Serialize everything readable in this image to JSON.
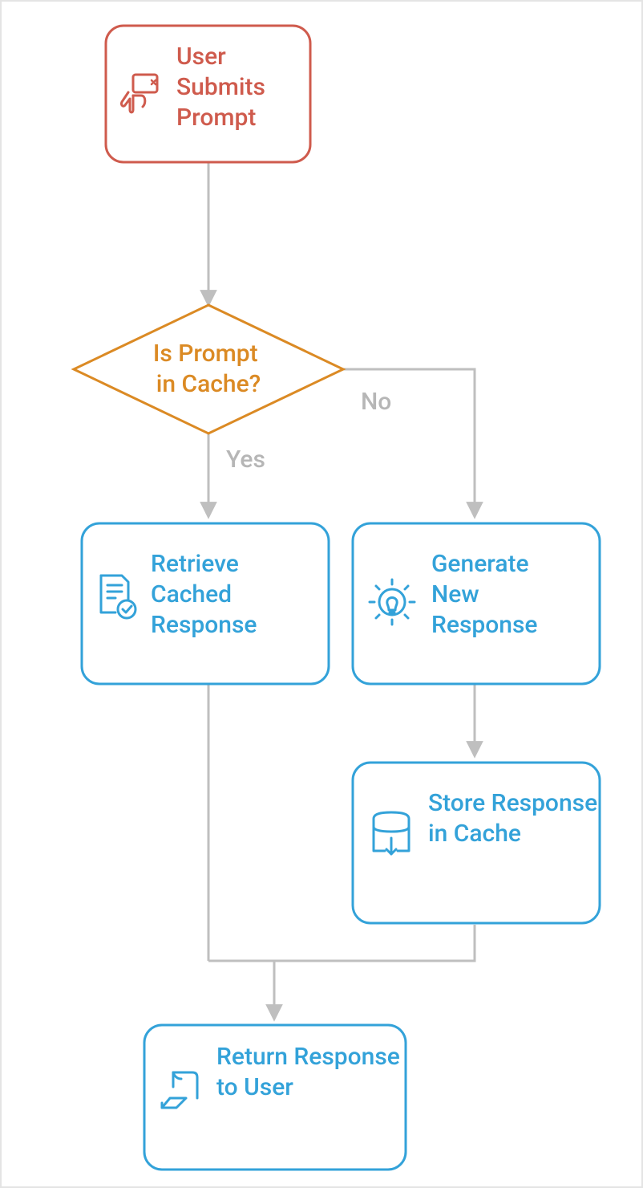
{
  "diagram": {
    "type": "flowchart",
    "direction": "top-to-bottom",
    "nodes": {
      "submit": {
        "label": "User Submits Prompt",
        "kind": "process",
        "color": "#cf5b4d",
        "icon": "touch-icon"
      },
      "decision": {
        "label": "Is Prompt in Cache?",
        "kind": "decision",
        "color": "#db8a24"
      },
      "retrieve": {
        "label": "Retrieve Cached Response",
        "kind": "process",
        "color": "#33a2d9",
        "icon": "doc-check-icon"
      },
      "generate": {
        "label": "Generate New Response",
        "kind": "process",
        "color": "#33a2d9",
        "icon": "gear-bulb-icon"
      },
      "store": {
        "label": "Store Response in Cache",
        "kind": "process",
        "color": "#33a2d9",
        "icon": "box-store-icon"
      },
      "return": {
        "label": "Return Response to User",
        "kind": "process",
        "color": "#33a2d9",
        "icon": "send-back-icon"
      }
    },
    "edges": [
      {
        "from": "submit",
        "to": "decision",
        "label": ""
      },
      {
        "from": "decision",
        "to": "retrieve",
        "label": "Yes"
      },
      {
        "from": "decision",
        "to": "generate",
        "label": "No"
      },
      {
        "from": "generate",
        "to": "store",
        "label": ""
      },
      {
        "from": "retrieve",
        "to": "return",
        "label": ""
      },
      {
        "from": "store",
        "to": "return",
        "label": ""
      }
    ]
  },
  "colors": {
    "edge": "#bfbfbf",
    "red": "#cf5b4d",
    "amber": "#db8a24",
    "blue": "#33a2d9"
  }
}
